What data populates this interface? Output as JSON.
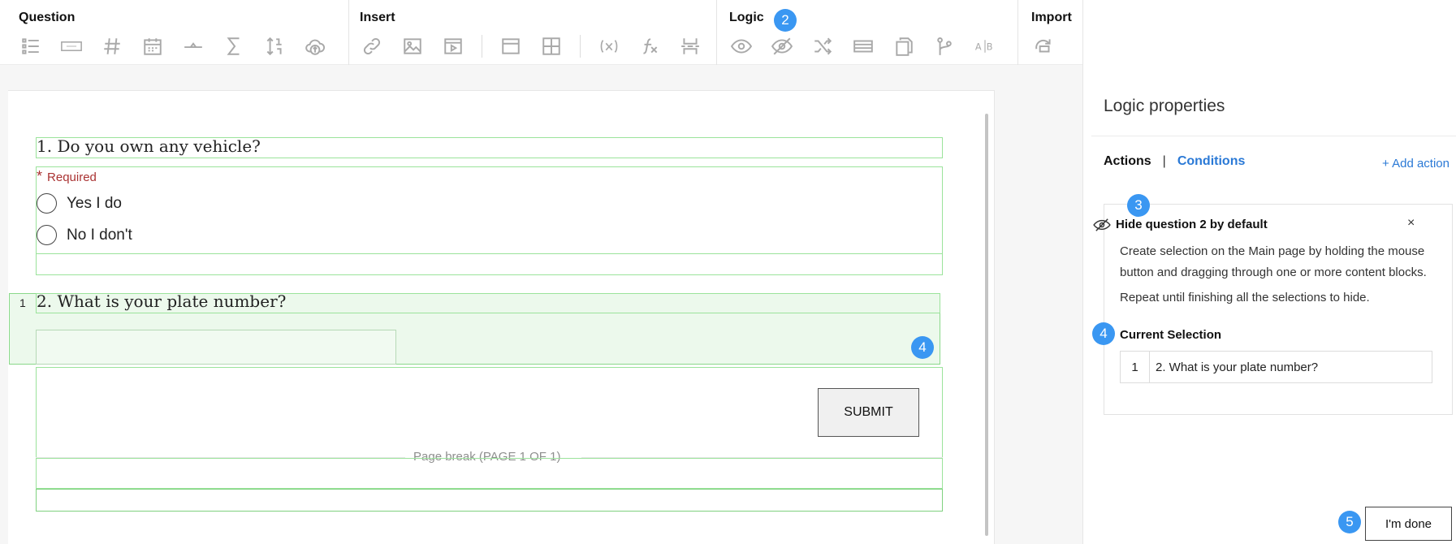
{
  "toolbar": {
    "groups": [
      {
        "label": "Question",
        "icons": [
          "list-icon",
          "text-field-icon",
          "number-hash-icon",
          "calendar-icon",
          "slider-icon",
          "sigma-icon",
          "sort-numeric-icon",
          "cloud-upload-icon"
        ]
      },
      {
        "label": "Insert",
        "icons": [
          "link-icon",
          "image-icon",
          "video-icon",
          "window-icon",
          "grid-icon",
          "variable-icon",
          "function-icon",
          "page-break-icon"
        ]
      },
      {
        "label": "Logic",
        "icons": [
          "eye-icon",
          "eye-off-icon",
          "shuffle-icon",
          "block-icon",
          "copy-icon",
          "branch-icon",
          "ab-icon"
        ]
      },
      {
        "label": "Import",
        "icons": [
          "import-icon"
        ]
      }
    ]
  },
  "badges": {
    "b2": "2",
    "b3": "3",
    "b4a": "4",
    "b4b": "4",
    "b5": "5"
  },
  "form": {
    "q1_title": "1. Do you own any vehicle?",
    "required_label": "Required",
    "required_star": "*",
    "options": [
      "Yes I do",
      "No I don't"
    ],
    "q2_number": "1",
    "q2_title": "2. What is your plate number?",
    "submit_label": "SUBMIT",
    "page_break_label": "Page break (PAGE 1 OF 1)"
  },
  "panel": {
    "title": "Logic properties",
    "tab_actions": "Actions",
    "tab_separator": "|",
    "tab_conditions": "Conditions",
    "add_action": "+ Add action",
    "card_title": "Hide question 2 by default",
    "close": "×",
    "instruction_1": "Create selection on the Main page by holding the mouse button and dragging through one or more content blocks.",
    "instruction_2": "Repeat until finishing all the selections to hide.",
    "current_selection_label": "Current Selection",
    "selection_row": {
      "index": "1",
      "text": "2. What is your plate number?"
    },
    "done_button": "I'm done"
  },
  "colors": {
    "accent": "#3a97f2",
    "link": "#2a79d6",
    "required": "#a33333",
    "selection_green": "#8ad88a"
  }
}
